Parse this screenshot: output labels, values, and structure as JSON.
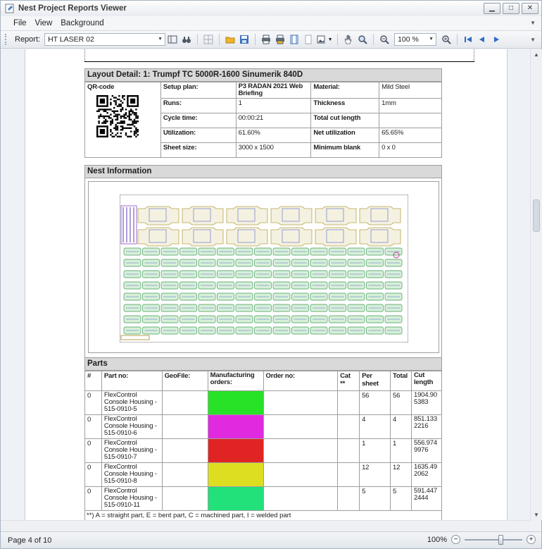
{
  "window": {
    "title": "Nest Project Reports Viewer"
  },
  "menu": [
    "File",
    "View",
    "Background"
  ],
  "toolbar": {
    "report_label": "Report:",
    "report_value": "HT LASER 02",
    "zoom_value": "100 %"
  },
  "layout_detail": {
    "title": "Layout Detail: 1: Trumpf TC 5000R-1600 Sinumerik 840D",
    "qr_label": "QR-code",
    "setup_plan_label": "Setup plan:",
    "setup_plan_value": "P3 RADAN 2021 Web Briefing",
    "material_label": "Material:",
    "material_value": "Mild Steel",
    "runs_label": "Runs:",
    "runs_value": "1",
    "thickness_label": "Thickness",
    "thickness_value": "1mm",
    "cycle_label": "Cycle time:",
    "cycle_value": "00:00:21",
    "cut_length_label": "Total cut length",
    "cut_length_value": "",
    "util_label": "Utilization:",
    "util_value": "61.60%",
    "net_util_label": "Net utilization",
    "net_util_value": "65.65%",
    "sheet_label": "Sheet size:",
    "sheet_value": "3000 x 1500",
    "min_blank_label": "Minimum blank",
    "min_blank_value": "0 x 0"
  },
  "nest": {
    "title": "Nest Information"
  },
  "parts": {
    "title": "Parts",
    "headers": {
      "num": "#",
      "part_no": "Part no:",
      "geofile": "GeoFile:",
      "mfg": "Manufacturing orders:",
      "order": "Order no:",
      "cat": "Cat **",
      "per_sheet": "Per sheet",
      "total": "Total",
      "cut": "Cut length"
    },
    "rows": [
      {
        "num": "0",
        "part": "FlexControl Console Housing - 515-0910-5",
        "color": "#27e227",
        "per_sheet": "56",
        "total": "56",
        "cut": "1904.905383"
      },
      {
        "num": "0",
        "part": "FlexControl Console Housing - 515-0910-6",
        "color": "#e02ae0",
        "per_sheet": "4",
        "total": "4",
        "cut": "851.1332216"
      },
      {
        "num": "0",
        "part": "FlexControl Console Housing - 515-0910-7",
        "color": "#e02424",
        "per_sheet": "1",
        "total": "1",
        "cut": "556.9749976"
      },
      {
        "num": "0",
        "part": "FlexControl Console Housing - 515-0910-8",
        "color": "#dddd22",
        "per_sheet": "12",
        "total": "12",
        "cut": "1635.492062"
      },
      {
        "num": "0",
        "part": "FlexControl Console Housing - 515-0910-11",
        "color": "#22e07a",
        "per_sheet": "5",
        "total": "5",
        "cut": "591.4472444"
      }
    ],
    "footnote": "**) A = straight part, E = bent part, C = machined part, I = welded part"
  },
  "status": {
    "page": "Page 4 of 10",
    "zoom": "100%"
  }
}
